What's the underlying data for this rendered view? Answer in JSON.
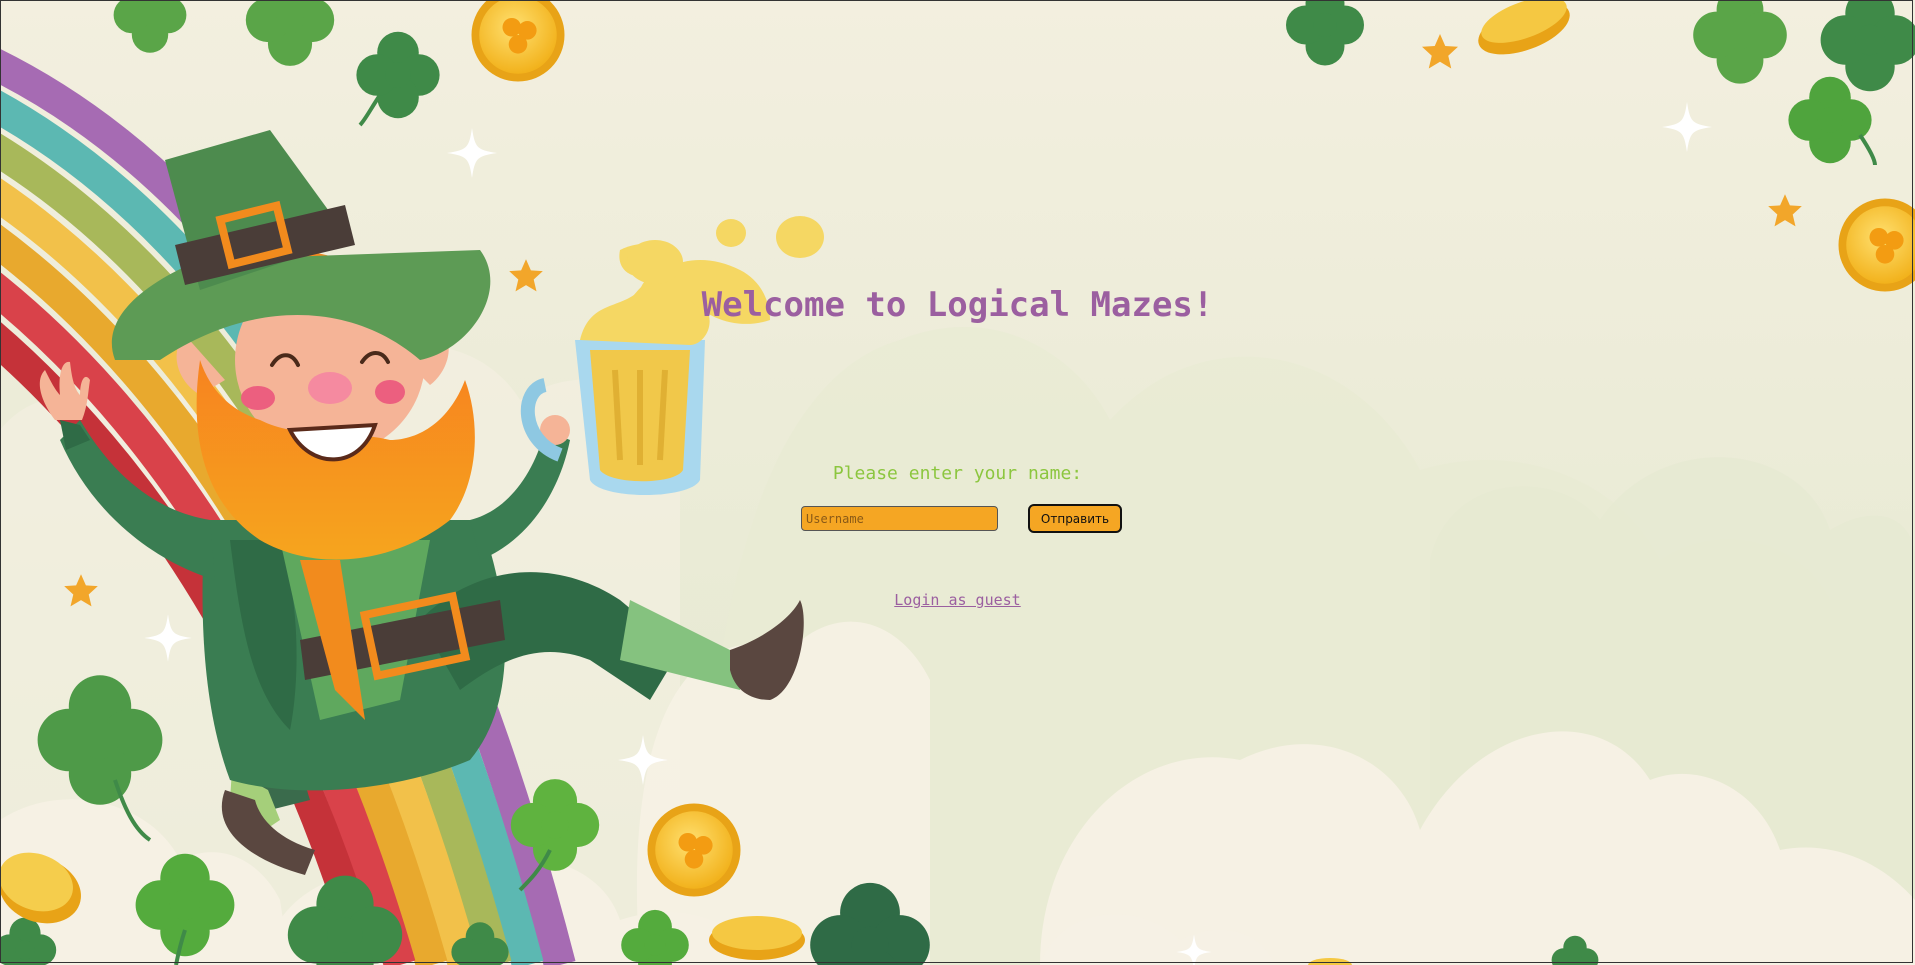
{
  "page": {
    "title": "Welcome to Logical Mazes!"
  },
  "login": {
    "prompt": "Please enter your name:",
    "username_placeholder": "Username",
    "username_value": "",
    "submit_label": "Отправить",
    "guest_link": "Login as guest"
  },
  "colors": {
    "background": "#eeeedc",
    "title": "#9b5fa0",
    "prompt": "#8cc63f",
    "button": "#f5a623",
    "link": "#9b5fa0"
  },
  "decorations": {
    "illustration": "leprechaun-with-beer-mug-and-rainbow",
    "icons": [
      "clover-icon",
      "gold-coin-icon",
      "star-icon",
      "sparkle-icon",
      "cloud"
    ]
  }
}
